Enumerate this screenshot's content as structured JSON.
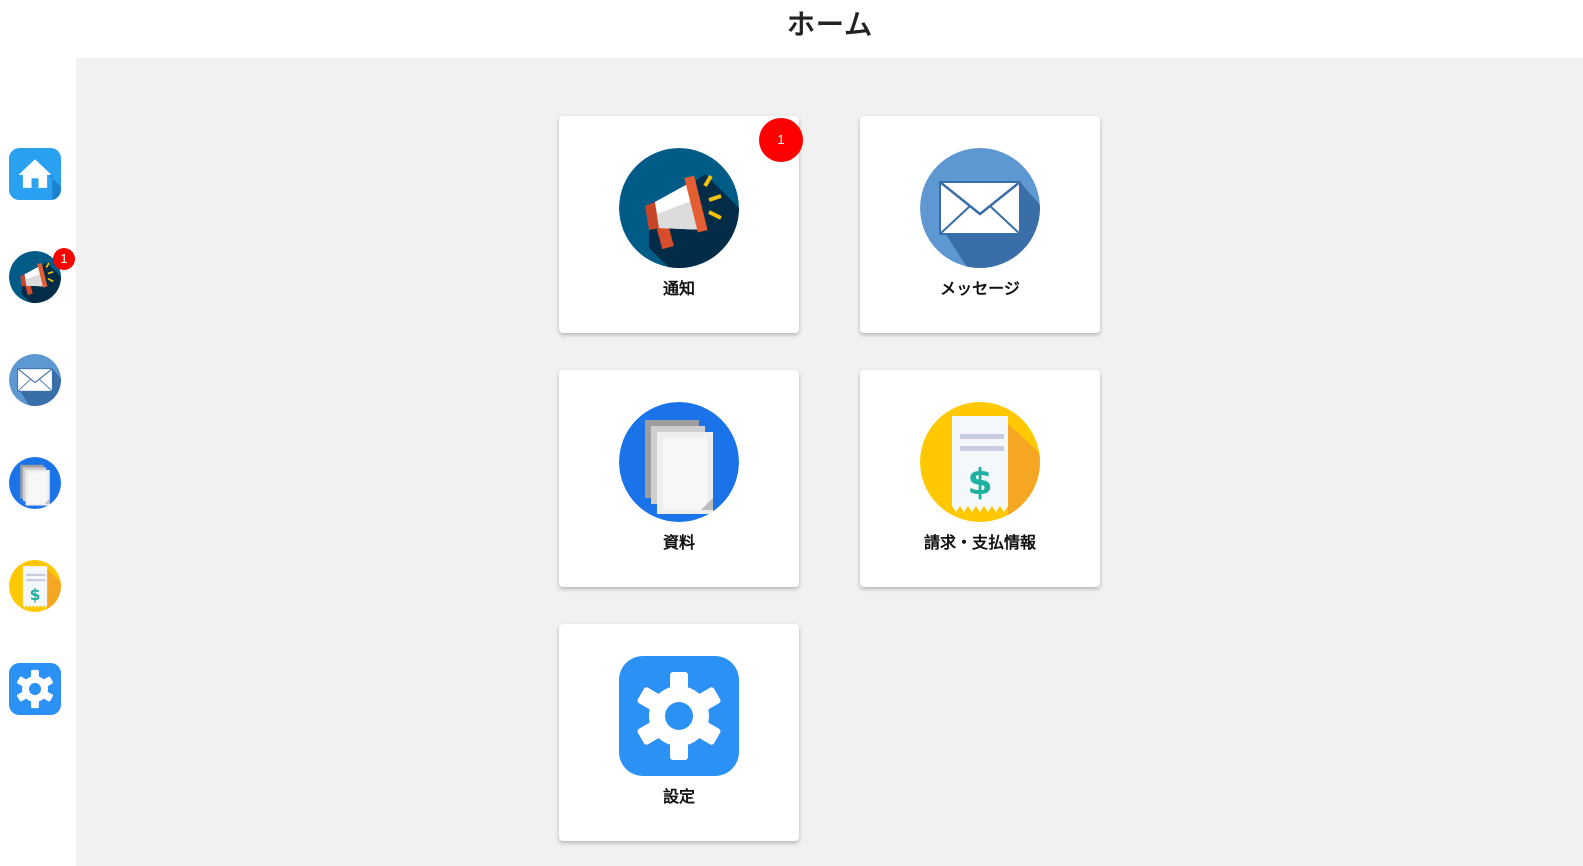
{
  "header": {
    "title": "ホーム"
  },
  "sidebar": {
    "items": [
      {
        "id": "home",
        "icon": "home-icon",
        "color": "#2aa0f0"
      },
      {
        "id": "notice",
        "icon": "megaphone-icon",
        "badge": "1",
        "color": "#005c87"
      },
      {
        "id": "message",
        "icon": "envelope-icon",
        "color": "#5e98d2"
      },
      {
        "id": "documents",
        "icon": "documents-icon",
        "color": "#1a73e8"
      },
      {
        "id": "billing",
        "icon": "receipt-icon",
        "color": "#ffc800"
      },
      {
        "id": "settings",
        "icon": "gear-icon",
        "color": "#2b91f5"
      }
    ]
  },
  "cards": [
    {
      "id": "notice",
      "label": "通知",
      "icon": "megaphone-icon",
      "badge": "1"
    },
    {
      "id": "message",
      "label": "メッセージ",
      "icon": "envelope-icon"
    },
    {
      "id": "documents",
      "label": "資料",
      "icon": "documents-icon"
    },
    {
      "id": "billing",
      "label": "請求・支払情報",
      "icon": "receipt-icon"
    },
    {
      "id": "settings",
      "label": "設定",
      "icon": "gear-icon"
    }
  ],
  "colors": {
    "badge": "#ff0000",
    "background": "#f1f1f1",
    "card": "#ffffff"
  }
}
